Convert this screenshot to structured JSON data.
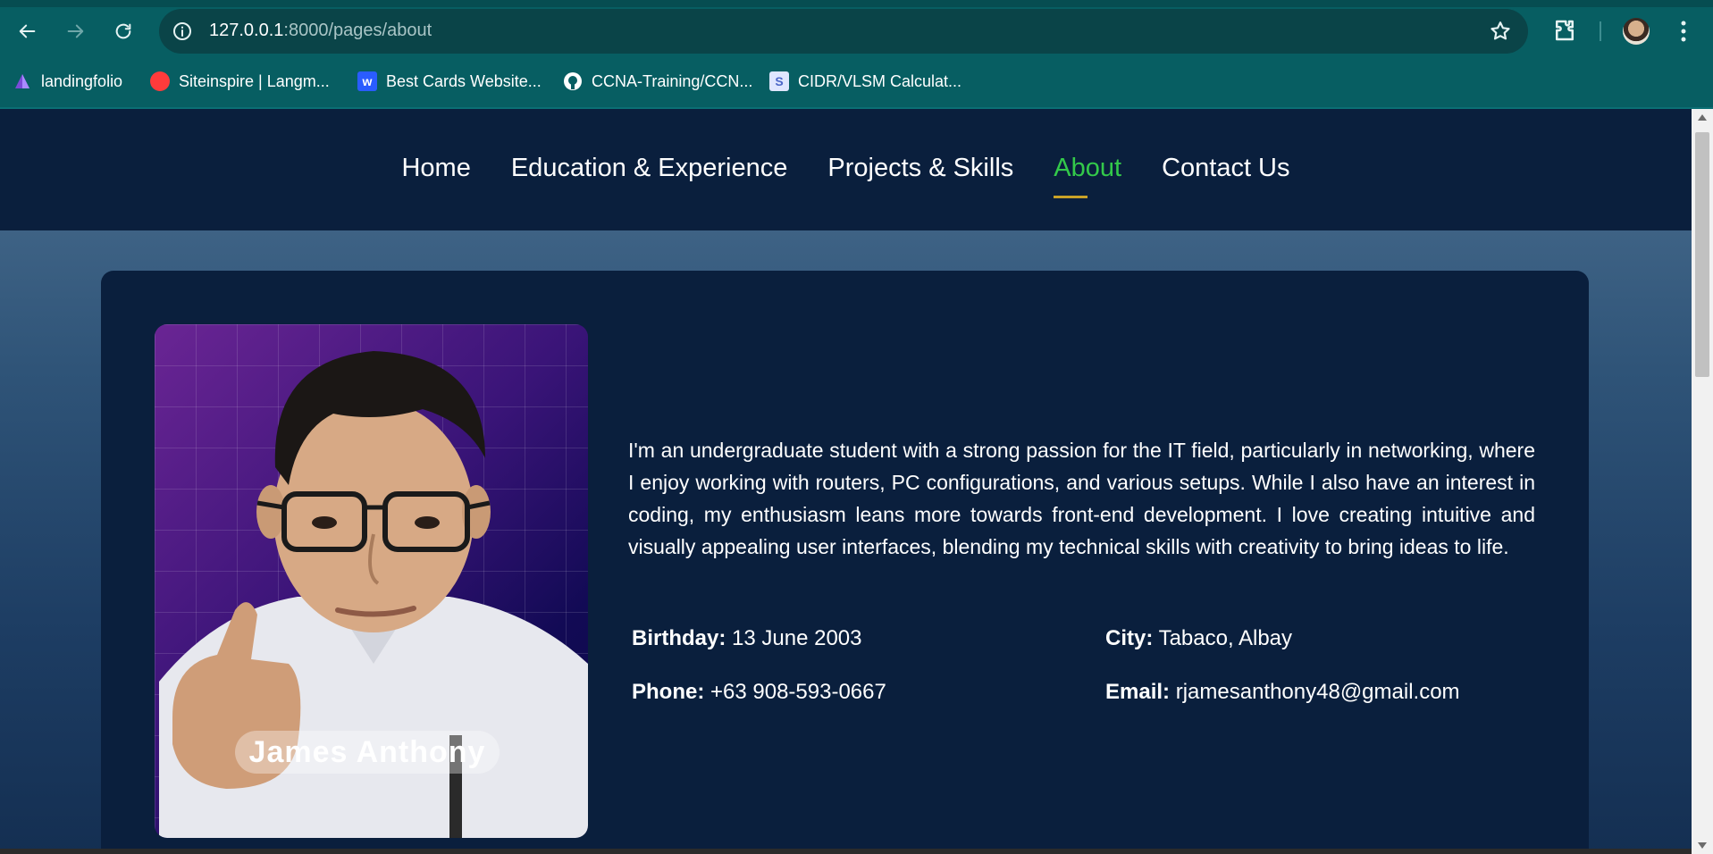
{
  "browser": {
    "url_host": "127.0.0.1",
    "url_rest": ":8000/pages/about",
    "icons": {
      "back": "arrow-left-icon",
      "forward": "arrow-right-icon",
      "reload": "reload-icon",
      "info": "info-icon",
      "bookmark": "star-icon",
      "extensions": "puzzle-icon",
      "menu": "kebab-menu-icon"
    },
    "bookmarks": [
      {
        "label": "landingfolio",
        "icon": "landingfolio-icon",
        "color": "#7b4bd8"
      },
      {
        "label": "Siteinspire | Langm...",
        "icon": "red-circle-icon",
        "color": "#ff3b3b"
      },
      {
        "label": "Best Cards Website...",
        "icon": "webflow-icon",
        "color": "#2a5cff"
      },
      {
        "label": "CCNA-Training/CCN...",
        "icon": "github-icon",
        "color": "#ffffff"
      },
      {
        "label": "CIDR/VLSM Calculat...",
        "icon": "subnet-s-icon",
        "color": "#4b66c8"
      }
    ]
  },
  "nav": {
    "items": [
      {
        "label": "Home",
        "active": false
      },
      {
        "label": "Education & Experience",
        "active": false
      },
      {
        "label": "Projects & Skills",
        "active": false
      },
      {
        "label": "About",
        "active": true
      },
      {
        "label": "Contact Us",
        "active": false
      }
    ],
    "active_color": "#33c94a",
    "underline_color": "#c9a227"
  },
  "about": {
    "photo_name": "James Anthony",
    "bio": "I'm an undergraduate student with a strong passion for the IT field, particularly in networking, where I enjoy working with routers, PC configurations, and various setups. While I also have an interest in coding, my enthusiasm leans more towards front-end development. I love creating intuitive and visually appealing user interfaces, blending my technical skills with creativity to bring ideas to life.",
    "details": {
      "birthday_label": "Birthday:",
      "birthday_value": "13 June 2003",
      "city_label": "City:",
      "city_value": "Tabaco, Albay",
      "phone_label": "Phone:",
      "phone_value": "+63 908-593-0667",
      "email_label": "Email:",
      "email_value": "rjamesanthony48@gmail.com"
    }
  },
  "colors": {
    "chrome": "#075e62",
    "page_dark": "#0a1f3d",
    "accent_green": "#33c94a"
  }
}
